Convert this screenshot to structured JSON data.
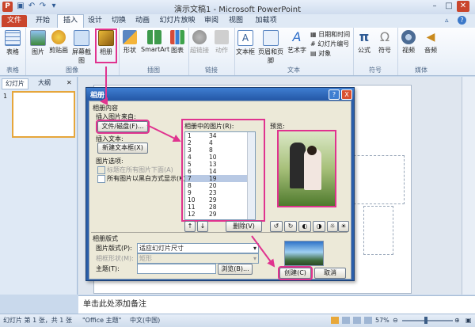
{
  "window": {
    "title": "演示文稿1 - Microsoft PowerPoint",
    "qat": [
      "save-icon",
      "undo-icon",
      "redo-icon",
      "customize-icon"
    ],
    "controls": [
      "minimize-icon",
      "maximize-icon",
      "close-icon"
    ]
  },
  "tabs": [
    {
      "label": "文件",
      "kind": "file"
    },
    {
      "label": "开始"
    },
    {
      "label": "插入",
      "active": true
    },
    {
      "label": "设计"
    },
    {
      "label": "切换"
    },
    {
      "label": "动画"
    },
    {
      "label": "幻灯片放映"
    },
    {
      "label": "审阅"
    },
    {
      "label": "视图"
    },
    {
      "label": "加载项"
    }
  ],
  "ribbon": {
    "groups": [
      {
        "label": "表格",
        "buttons": [
          "表格"
        ]
      },
      {
        "label": "图像",
        "buttons": [
          "图片",
          "剪贴画",
          "屏幕截图",
          "相册"
        ]
      },
      {
        "label": "插图",
        "buttons": [
          "形状",
          "SmartArt",
          "图表"
        ]
      },
      {
        "label": "链接",
        "buttons": [
          "超链接",
          "动作"
        ]
      },
      {
        "label": "文本",
        "buttons": [
          "文本框",
          "页眉和页脚",
          "艺术字"
        ],
        "small": [
          "日期和时间",
          "幻灯片编号",
          "对象"
        ]
      },
      {
        "label": "符号",
        "buttons": [
          "公式",
          "符号"
        ]
      },
      {
        "label": "媒体",
        "buttons": [
          "视频",
          "音频"
        ]
      }
    ]
  },
  "pane": {
    "tabs": [
      "幻灯片",
      "大纲"
    ],
    "slide_number": "1"
  },
  "notes_placeholder": "单击此处添加备注",
  "status": {
    "slide": "幻灯片 第 1 张，共 1 张",
    "theme": "\"Office 主题\"",
    "language": "中文(中国)",
    "zoom": "57%"
  },
  "dialog": {
    "title": "相册",
    "help": "?",
    "close": "X",
    "section_content": "相册内容",
    "insert_from": "插入图片来自:",
    "file_button": "文件/磁盘(F)...",
    "insert_text": "插入文本:",
    "new_textbox_button": "新建文本框(X)",
    "picture_options": "图片选项:",
    "option_captions": "标题在所有图片下面(A)",
    "option_bw": "所有图片以黑白方式显示(K)",
    "list_label": "相册中的图片(R):",
    "preview_label": "预览:",
    "list_rows": [
      [
        "1",
        "34"
      ],
      [
        "2",
        "4"
      ],
      [
        "3",
        "8"
      ],
      [
        "4",
        "10"
      ],
      [
        "5",
        "13"
      ],
      [
        "6",
        "14"
      ],
      [
        "7",
        "19"
      ],
      [
        "8",
        "20"
      ],
      [
        "9",
        "23"
      ],
      [
        "10",
        "29"
      ],
      [
        "11",
        "28"
      ],
      [
        "12",
        "29"
      ]
    ],
    "selected_row": 6,
    "remove_button": "删除(V)",
    "layout_section": "相册版式",
    "picture_layout_label": "图片版式(P):",
    "picture_layout_value": "适应幻灯片尺寸",
    "frame_shape_label": "相框形状(M):",
    "frame_shape_value": "矩形",
    "theme_label": "主题(T):",
    "theme_value": "",
    "browse_button": "浏览(B)...",
    "create_button": "创建(C)",
    "cancel_button": "取消"
  }
}
